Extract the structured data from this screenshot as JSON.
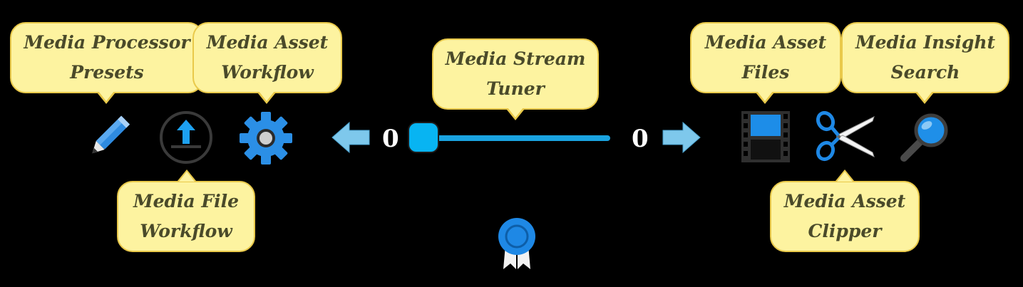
{
  "toolbar": {
    "callouts": {
      "presets": "Media Processor\nPresets",
      "asset_workflow": "Media Asset\nWorkflow",
      "file_workflow": "Media File\nWorkflow",
      "stream_tuner": "Media Stream\nTuner",
      "asset_files": "Media Asset\nFiles",
      "insight_search": "Media Insight\nSearch",
      "asset_clipper": "Media Asset\nClipper"
    },
    "icons": {
      "presets": "pencil-icon",
      "file_workflow": "upload-icon",
      "asset_workflow": "gear-icon",
      "prev": "arrow-left-icon",
      "next": "arrow-right-icon",
      "asset_files": "film-strip-icon",
      "asset_clipper": "scissors-icon",
      "insight_search": "magnifier-icon",
      "badge": "award-ribbon-icon"
    }
  },
  "stream_tuner": {
    "left_value": "0",
    "right_value": "0",
    "position": 0
  },
  "colors": {
    "background": "#000000",
    "callout_fill": "#fdf3a0",
    "callout_border": "#e9c94a",
    "accent": "#1aa3e0"
  }
}
